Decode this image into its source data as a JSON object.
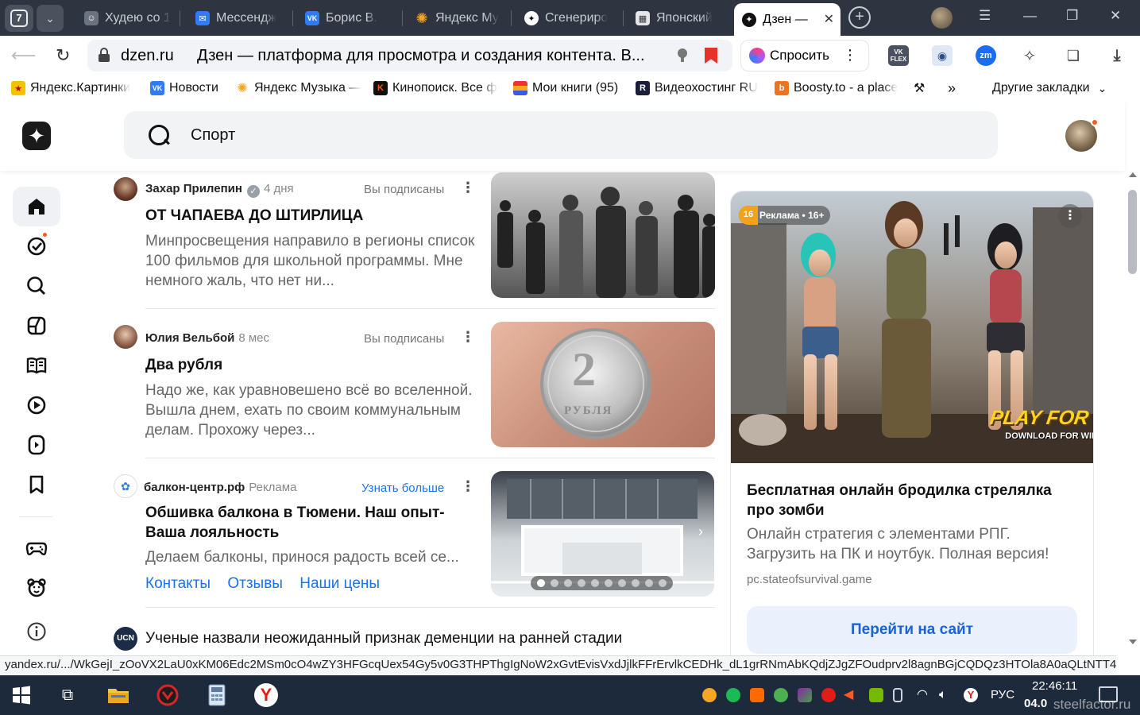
{
  "browser": {
    "tab_count": "7",
    "tabs": [
      {
        "title": "Худею со 1",
        "fav_color": "#6b7280",
        "fav_glyph": "☺"
      },
      {
        "title": "Мессендж",
        "fav_color": "#2f7cf6",
        "fav_glyph": "✉"
      },
      {
        "title": "Борис В.",
        "fav_color": "#2f7cf6",
        "fav_glyph": "VK"
      },
      {
        "title": "Яндекс Му",
        "fav_color": "#f5a623",
        "fav_glyph": "✺"
      },
      {
        "title": "Сгенериро",
        "fav_color": "#111111",
        "fav_glyph": "✦"
      },
      {
        "title": "Японский",
        "fav_color": "#9aa0a8",
        "fav_glyph": "▦"
      },
      {
        "title": "Дзен —",
        "fav_color": "#111111",
        "fav_glyph": "✦"
      }
    ],
    "address": {
      "domain": "dzen.ru",
      "page_title": "Дзен — платформа для просмотра и создания контента. В..."
    },
    "ask_button": "Спросить",
    "bookmarks": [
      {
        "label": "Яндекс.Картинки",
        "color": "#f5c400",
        "glyph": "★"
      },
      {
        "label": "Новости",
        "color": "#2f7cf6",
        "glyph": "VK"
      },
      {
        "label": "Яндекс Музыка —",
        "color": "#f5a623",
        "glyph": "✺"
      },
      {
        "label": "Кинопоиск. Все ф",
        "color": "#ff5a00",
        "glyph": "K"
      },
      {
        "label": "Мои книги (95)",
        "color": "#3b5bdb",
        "glyph": "≡"
      },
      {
        "label": "Видеохостинг RU",
        "color": "#1b1f3b",
        "glyph": "R"
      },
      {
        "label": "Boosty.to - a place",
        "color": "#f0731d",
        "glyph": "b"
      }
    ],
    "more_bookmarks": "»",
    "other_bookmarks": "Другие закладки"
  },
  "page": {
    "search_value": "Спорт",
    "feed": [
      {
        "author": "Захар Прилепин",
        "meta": "4 дня",
        "subscribed": "Вы подписаны",
        "title": "ОТ ЧАПАЕВА ДО ШТИРЛИЦА",
        "desc": "Минпросвещения направило в регионы список 100 фильмов для школьной программы. Мне немного жаль, что нет ни..."
      },
      {
        "author": "Юлия Вельбой",
        "meta": "8 мес",
        "subscribed": "Вы подписаны",
        "title": "Два рубля",
        "desc": "Надо же, как уравновешено всё во вселенной. Вышла днем, ехать по своим коммунальным делам. Прохожу через..."
      },
      {
        "author": "балкон-центр.рф",
        "meta": "Реклама",
        "cta": "Узнать больше",
        "title": "Обшивка балкона в Тюмени. Наш опыт- Ваша лояльность",
        "desc": "Делаем балконы, принося радость всей се...",
        "links": [
          "Контакты",
          "Отзывы",
          "Наши цены"
        ]
      },
      {
        "author_badge": "UCN",
        "title": "Ученые назвали неожиданный признак деменции на ранней стадии"
      }
    ],
    "coin": {
      "number": "2",
      "word": "РУБЛЯ"
    },
    "ad": {
      "label": "Реклама • 16+",
      "age_badge": "16",
      "banner_title": "PLAY FOR F",
      "banner_sub": "DOWNLOAD FOR WIN",
      "title": "Бесплатная онлайн бродилка стрелялка про зомби",
      "desc": "Онлайн стратегия с элементами РПГ. Загрузить на ПК и ноутбук. Полная версия!",
      "domain": "pc.stateofsurvival.game",
      "cta": "Перейти на сайт"
    }
  },
  "status_url": "yandex.ru/.../WkGejI_zOoVX2LaU0xKM06Edc2MSm0cO4wZY3HFGcqUex54Gy5v0G3THPThgIgNoW2xGvtEvisVxdJjlkFFrErvlkCEDHk_dL1grRNmAbKQdjZJgZFOudprv2l8agnBGjCQDQz3HTOla8A0aQLtNTT4...",
  "taskbar": {
    "lang": "РУС",
    "time": "22:46:11",
    "date": "04.0",
    "watermark": "steelfactor.ru"
  }
}
